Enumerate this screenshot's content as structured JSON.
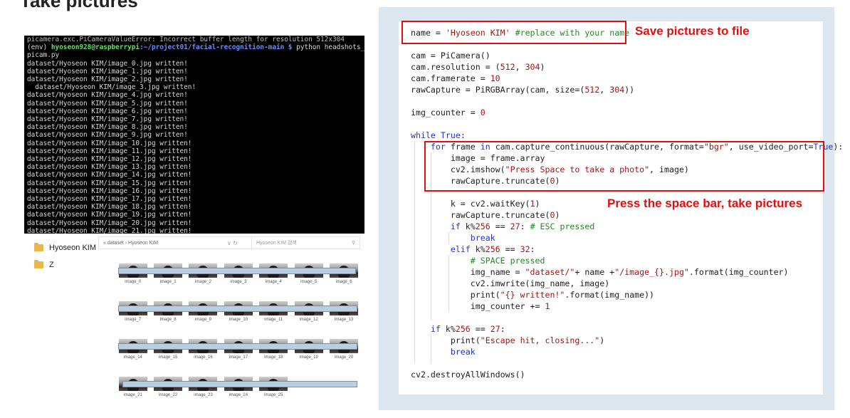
{
  "heading": "Take pictures",
  "terminal": {
    "error_line": "picamera.exc.PiCameraValueError: Incorrect buffer length for resolution 512x304",
    "prompt_env": "(env) ",
    "prompt_user": "hyoseon928@raspberrypi",
    "prompt_path": ":~/project01/facial-recognition-main $ ",
    "command": "python headshots_",
    "command_cont": "picam.py",
    "outputs": [
      "dataset/Hyoseon KIM/image_0.jpg written!",
      "dataset/Hyoseon KIM/image_1.jpg written!",
      "dataset/Hyoseon KIM/image_2.jpg written!",
      "  dataset/Hyoseon KIM/image_3.jpg written!",
      "dataset/Hyoseon KIM/image_4.jpg written!",
      "dataset/Hyoseon KIM/image_5.jpg written!",
      "dataset/Hyoseon KIM/image_6.jpg written!",
      "dataset/Hyoseon KIM/image_7.jpg written!",
      "dataset/Hyoseon KIM/image_8.jpg written!",
      "dataset/Hyoseon KIM/image_9.jpg written!",
      "dataset/Hyoseon KIM/image_10.jpg written!",
      "dataset/Hyoseon KIM/image_11.jpg written!",
      "dataset/Hyoseon KIM/image_12.jpg written!",
      "dataset/Hyoseon KIM/image_13.jpg written!",
      "dataset/Hyoseon KIM/image_14.jpg written!",
      "dataset/Hyoseon KIM/image_15.jpg written!",
      "dataset/Hyoseon KIM/image_16.jpg written!",
      "dataset/Hyoseon KIM/image_17.jpg written!",
      "dataset/Hyoseon KIM/image_18.jpg written!",
      "dataset/Hyoseon KIM/image_19.jpg written!",
      "dataset/Hyoseon KIM/image_20.jpg written!",
      "dataset/Hyoseon KIM/image_21.jpg written!"
    ]
  },
  "explorer": {
    "sidebar": [
      {
        "label": "Hyoseon KIM",
        "icon": "folder-icon"
      },
      {
        "label": "Z",
        "icon": "folder-icon"
      }
    ],
    "breadcrumb": "« dataset › Hyoseon KIM",
    "nav_icons": "∨  ↻",
    "search_placeholder": "Hyoseon KIM 검색",
    "rows": [
      [
        "image_0",
        "image_1",
        "image_2",
        "image_3",
        "image_4",
        "image_5",
        "image_6"
      ],
      [
        "image_7",
        "image_8",
        "image_9",
        "image_10",
        "image_11",
        "image_12",
        "image_13"
      ],
      [
        "image_14",
        "image_15",
        "image_16",
        "image_17",
        "image_18",
        "image_19",
        "image_20"
      ],
      [
        "image_21",
        "image_22",
        "image_23",
        "image_24",
        "image_25"
      ]
    ]
  },
  "code": {
    "lines": [
      [
        [
          "name = ",
          ""
        ],
        [
          "'Hyoseon KIM'",
          "str"
        ],
        [
          " #replace with your name",
          "cmt"
        ]
      ],
      [],
      [
        [
          "cam = PiCamera()",
          ""
        ]
      ],
      [
        [
          "cam.resolution = (",
          ""
        ],
        [
          "512",
          "str"
        ],
        [
          ", ",
          ""
        ],
        [
          "304",
          "str"
        ],
        [
          ")",
          ""
        ]
      ],
      [
        [
          "cam.framerate = ",
          ""
        ],
        [
          "10",
          "str"
        ]
      ],
      [
        [
          "rawCapture = PiRGBArray(cam, size=(",
          ""
        ],
        [
          "512",
          "str"
        ],
        [
          ", ",
          ""
        ],
        [
          "304",
          "str"
        ],
        [
          "))",
          ""
        ]
      ],
      [],
      [
        [
          "img_counter = ",
          ""
        ],
        [
          "0",
          "str"
        ]
      ],
      [],
      [
        [
          "while",
          "kw"
        ],
        [
          " ",
          ""
        ],
        [
          "True",
          "kw"
        ],
        [
          ":",
          ""
        ]
      ],
      [
        [
          "    ",
          ""
        ],
        [
          "for",
          "kw"
        ],
        [
          " frame ",
          ""
        ],
        [
          "in",
          "kw"
        ],
        [
          " cam.capture_continuous(rawCapture, format=",
          ""
        ],
        [
          "\"bgr\"",
          "str"
        ],
        [
          ", use_video_port=",
          ""
        ],
        [
          "True",
          "kw"
        ],
        [
          "):",
          ""
        ]
      ],
      [
        [
          "        image = frame.array",
          ""
        ]
      ],
      [
        [
          "        cv2.imshow(",
          ""
        ],
        [
          "\"Press Space to take a photo\"",
          "str"
        ],
        [
          ", image)",
          ""
        ]
      ],
      [
        [
          "        rawCapture.truncate(",
          ""
        ],
        [
          "0",
          "str"
        ],
        [
          ")",
          ""
        ]
      ],
      [],
      [
        [
          "        k = cv2.waitKey(",
          ""
        ],
        [
          "1",
          "str"
        ],
        [
          ")",
          ""
        ]
      ],
      [
        [
          "        rawCapture.truncate(",
          ""
        ],
        [
          "0",
          "str"
        ],
        [
          ")",
          ""
        ]
      ],
      [
        [
          "        ",
          ""
        ],
        [
          "if",
          "kw"
        ],
        [
          " k%",
          ""
        ],
        [
          "256",
          "str"
        ],
        [
          " == ",
          ""
        ],
        [
          "27",
          "str"
        ],
        [
          ": ",
          ""
        ],
        [
          "# ESC pressed",
          "cmt"
        ]
      ],
      [
        [
          "            ",
          ""
        ],
        [
          "break",
          "kw"
        ]
      ],
      [
        [
          "        ",
          ""
        ],
        [
          "elif",
          "kw"
        ],
        [
          " k%",
          ""
        ],
        [
          "256",
          "str"
        ],
        [
          " == ",
          ""
        ],
        [
          "32",
          "str"
        ],
        [
          ":",
          ""
        ]
      ],
      [
        [
          "            ",
          ""
        ],
        [
          "# SPACE pressed",
          "cmt"
        ]
      ],
      [
        [
          "            img_name = ",
          ""
        ],
        [
          "\"dataset/\"",
          "str"
        ],
        [
          "+ name +",
          ""
        ],
        [
          "\"/image_{}.jpg\"",
          "str"
        ],
        [
          ".format(img_counter)",
          ""
        ]
      ],
      [
        [
          "            cv2.imwrite(img_name, image)",
          ""
        ]
      ],
      [
        [
          "            print(",
          ""
        ],
        [
          "\"{} written!\"",
          "str"
        ],
        [
          ".format(img_name))",
          ""
        ]
      ],
      [
        [
          "            img_counter += ",
          ""
        ],
        [
          "1",
          "str"
        ]
      ],
      [],
      [
        [
          "    ",
          ""
        ],
        [
          "if",
          "kw"
        ],
        [
          " k%",
          ""
        ],
        [
          "256",
          "str"
        ],
        [
          " == ",
          ""
        ],
        [
          "27",
          "str"
        ],
        [
          ":",
          ""
        ]
      ],
      [
        [
          "        print(",
          ""
        ],
        [
          "\"Escape hit, closing...\"",
          "str"
        ],
        [
          ")",
          ""
        ]
      ],
      [
        [
          "        ",
          ""
        ],
        [
          "break",
          "kw"
        ]
      ],
      [],
      [
        [
          "cv2.destroyAllWindows()",
          ""
        ]
      ]
    ]
  },
  "annotations": {
    "save": "Save pictures to file",
    "press": "Press the space bar, take pictures"
  },
  "colors": {
    "annotation_red": "#e01010",
    "terminal_user_green": "#5fe35f",
    "terminal_path_blue": "#6b8cff",
    "code_panel_bg": "#dde7f0"
  }
}
